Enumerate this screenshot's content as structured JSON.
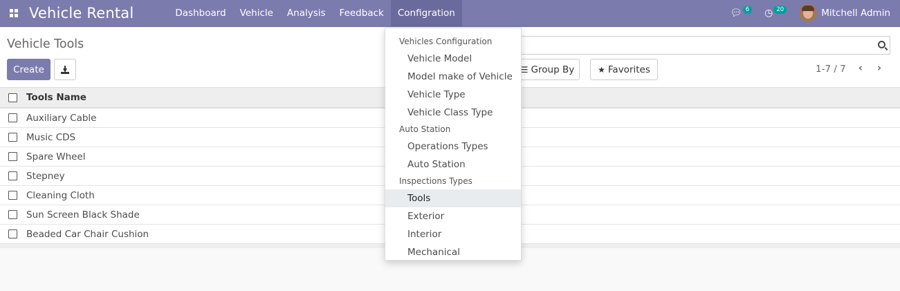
{
  "navbar": {
    "app_title": "Vehicle Rental",
    "menu": [
      "Dashboard",
      "Vehicle",
      "Analysis",
      "Feedback",
      "Configration"
    ],
    "active_menu": "Configration",
    "messages_count": "6",
    "activities_count": "20",
    "user_name": "Mitchell Admin"
  },
  "control_panel": {
    "title": "Vehicle Tools",
    "create_label": "Create",
    "groupby_label": "Group By",
    "favorites_label": "Favorites",
    "pager": "1-7 / 7"
  },
  "list": {
    "column_header": "Tools Name",
    "rows": [
      "Auxiliary Cable",
      "Music CDS",
      "Spare Wheel",
      "Stepney",
      "Cleaning Cloth",
      "Sun Screen Black Shade",
      "Beaded Car Chair Cushion"
    ]
  },
  "dropdown": {
    "sections": [
      {
        "header": "Vehicles Configuration",
        "items": [
          "Vehicle Model",
          "Model make of Vehicle",
          "Vehicle Type",
          "Vehicle Class Type"
        ]
      },
      {
        "header": "Auto Station",
        "items": [
          "Operations Types",
          "Auto Station"
        ]
      },
      {
        "header": "Inspections Types",
        "items": [
          "Tools",
          "Exterior",
          "Interior",
          "Mechanical"
        ]
      }
    ],
    "active_item": "Tools"
  },
  "colors": {
    "brand": "#7c7bad",
    "badge": "#00a09d"
  }
}
